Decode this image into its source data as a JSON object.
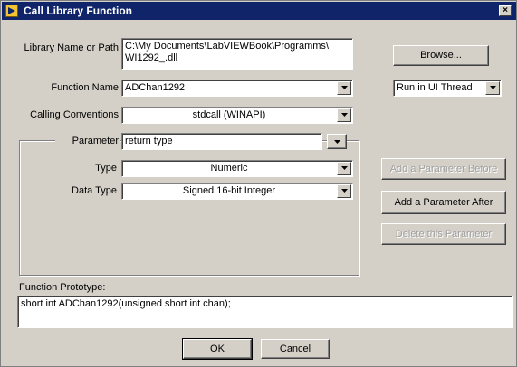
{
  "window": {
    "title": "Call Library Function",
    "close_glyph": "×"
  },
  "library": {
    "label": "Library Name or Path",
    "value": "C:\\My Documents\\LabVIEWBook\\Programms\\\nWI1292_.dll",
    "browse_label": "Browse..."
  },
  "function": {
    "label": "Function Name",
    "value": "ADChan1292",
    "thread_value": "Run in UI Thread"
  },
  "calling": {
    "label": "Calling Conventions",
    "value": "stdcall (WINAPI)"
  },
  "parameter": {
    "label": "Parameter",
    "value": "return type",
    "type_label": "Type",
    "type_value": "Numeric",
    "datatype_label": "Data Type",
    "datatype_value": "Signed 16-bit Integer"
  },
  "actions": {
    "add_before": "Add a Parameter Before",
    "add_after": "Add a Parameter After",
    "delete": "Delete this Parameter"
  },
  "prototype": {
    "label": "Function Prototype:",
    "value": "short int ADChan1292(unsigned short int chan);"
  },
  "footer": {
    "ok_label": "OK",
    "cancel_label": "Cancel"
  },
  "icons": {
    "title": "labview-dialog-icon",
    "dropdown": "chevron-down-icon",
    "close": "close-icon"
  }
}
